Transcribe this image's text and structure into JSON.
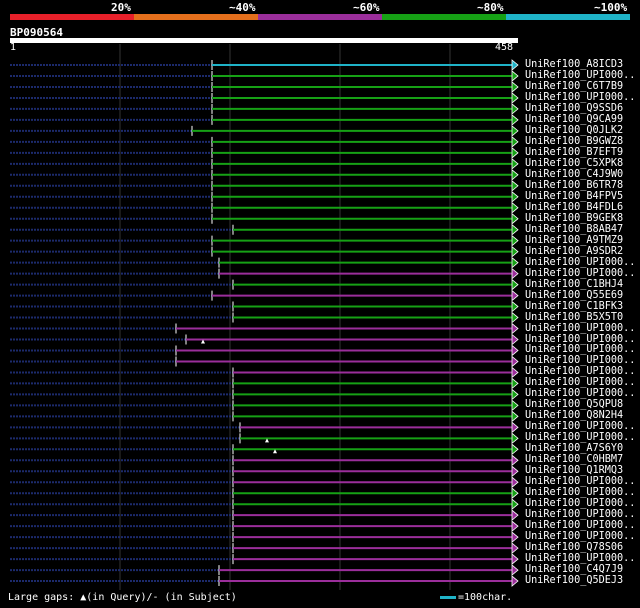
{
  "query": {
    "id": "BP090564",
    "start": "1",
    "end": "458"
  },
  "percent_labels": [
    "20%",
    "~40%",
    "~60%",
    "~80%",
    "~100%"
  ],
  "colorbar": [
    "#e8202a",
    "#e46f1c",
    "#9b2e9b",
    "#16a115",
    "#1fb3c8"
  ],
  "colors": {
    "background": "#000000",
    "grid": "#333333",
    "dots": "#1c2a6b",
    "cyan": "#1fb3c8",
    "green": "#16a115",
    "purple": "#9b2e9b"
  },
  "hits": [
    {
      "name": "UniRef100_A8ICD3",
      "start": 212,
      "color": "cyan"
    },
    {
      "name": "UniRef100_UPI000..",
      "start": 212,
      "color": "green"
    },
    {
      "name": "UniRef100_C6T7B9",
      "start": 212,
      "color": "green"
    },
    {
      "name": "UniRef100_UPI000..",
      "start": 212,
      "color": "green"
    },
    {
      "name": "UniRef100_Q9SSD6",
      "start": 212,
      "color": "green"
    },
    {
      "name": "UniRef100_Q9CA99",
      "start": 212,
      "color": "green"
    },
    {
      "name": "UniRef100_Q0JLK2",
      "start": 192,
      "color": "green"
    },
    {
      "name": "UniRef100_B9GWZ8",
      "start": 212,
      "color": "green"
    },
    {
      "name": "UniRef100_B7EFT9",
      "start": 212,
      "color": "green"
    },
    {
      "name": "UniRef100_C5XPK8",
      "start": 212,
      "color": "green"
    },
    {
      "name": "UniRef100_C4J9W0",
      "start": 212,
      "color": "green"
    },
    {
      "name": "UniRef100_B6TR78",
      "start": 212,
      "color": "green"
    },
    {
      "name": "UniRef100_B4FPV5",
      "start": 212,
      "color": "green"
    },
    {
      "name": "UniRef100_B4FDL6",
      "start": 212,
      "color": "green"
    },
    {
      "name": "UniRef100_B9GEK8",
      "start": 212,
      "color": "green"
    },
    {
      "name": "UniRef100_B8AB47",
      "start": 233,
      "color": "green"
    },
    {
      "name": "UniRef100_A9TMZ9",
      "start": 212,
      "color": "green"
    },
    {
      "name": "UniRef100_A9SDR2",
      "start": 212,
      "color": "green"
    },
    {
      "name": "UniRef100_UPI000..",
      "start": 219,
      "color": "green"
    },
    {
      "name": "UniRef100_UPI000..",
      "start": 219,
      "color": "purple"
    },
    {
      "name": "UniRef100_C1BHJ4",
      "start": 233,
      "color": "green"
    },
    {
      "name": "UniRef100_Q55E69",
      "start": 212,
      "color": "purple"
    },
    {
      "name": "UniRef100_C1BFK3",
      "start": 233,
      "color": "green"
    },
    {
      "name": "UniRef100_B5X5T0",
      "start": 233,
      "color": "green"
    },
    {
      "name": "UniRef100_UPI000..",
      "start": 176,
      "color": "purple"
    },
    {
      "name": "UniRef100_UPI000..",
      "start": 186,
      "color": "purple",
      "gap": 203
    },
    {
      "name": "UniRef100_UPI000..",
      "start": 176,
      "color": "purple"
    },
    {
      "name": "UniRef100_UPI000..",
      "start": 176,
      "color": "purple"
    },
    {
      "name": "UniRef100_UPI000..",
      "start": 233,
      "color": "purple"
    },
    {
      "name": "UniRef100_UPI000..",
      "start": 233,
      "color": "green"
    },
    {
      "name": "UniRef100_UPI000..",
      "start": 233,
      "color": "green"
    },
    {
      "name": "UniRef100_Q5QPU8",
      "start": 233,
      "color": "green"
    },
    {
      "name": "UniRef100_Q8N2H4",
      "start": 233,
      "color": "green"
    },
    {
      "name": "UniRef100_UPI000..",
      "start": 240,
      "color": "purple"
    },
    {
      "name": "UniRef100_UPI000..",
      "start": 240,
      "color": "green",
      "gap": 267
    },
    {
      "name": "UniRef100_A7S6Y0",
      "start": 233,
      "color": "green",
      "gap": 275
    },
    {
      "name": "UniRef100_C0HBM7",
      "start": 233,
      "color": "purple"
    },
    {
      "name": "UniRef100_Q1RMQ3",
      "start": 233,
      "color": "purple"
    },
    {
      "name": "UniRef100_UPI000..",
      "start": 233,
      "color": "purple"
    },
    {
      "name": "UniRef100_UPI000..",
      "start": 233,
      "color": "green"
    },
    {
      "name": "UniRef100_UPI000..",
      "start": 233,
      "color": "green"
    },
    {
      "name": "UniRef100_UPI000..",
      "start": 233,
      "color": "purple"
    },
    {
      "name": "UniRef100_UPI000..",
      "start": 233,
      "color": "purple"
    },
    {
      "name": "UniRef100_UPI000..",
      "start": 233,
      "color": "purple"
    },
    {
      "name": "UniRef100_Q78S06",
      "start": 233,
      "color": "purple"
    },
    {
      "name": "UniRef100_UPI000..",
      "start": 233,
      "color": "purple"
    },
    {
      "name": "UniRef100_C4Q7J9",
      "start": 219,
      "color": "purple"
    },
    {
      "name": "UniRef100_Q5DEJ3",
      "start": 219,
      "color": "purple"
    }
  ],
  "footer": {
    "text_a": "Large gaps: ",
    "text_b": "(in Query)/- (in Subject)",
    "scale": "=100char."
  }
}
